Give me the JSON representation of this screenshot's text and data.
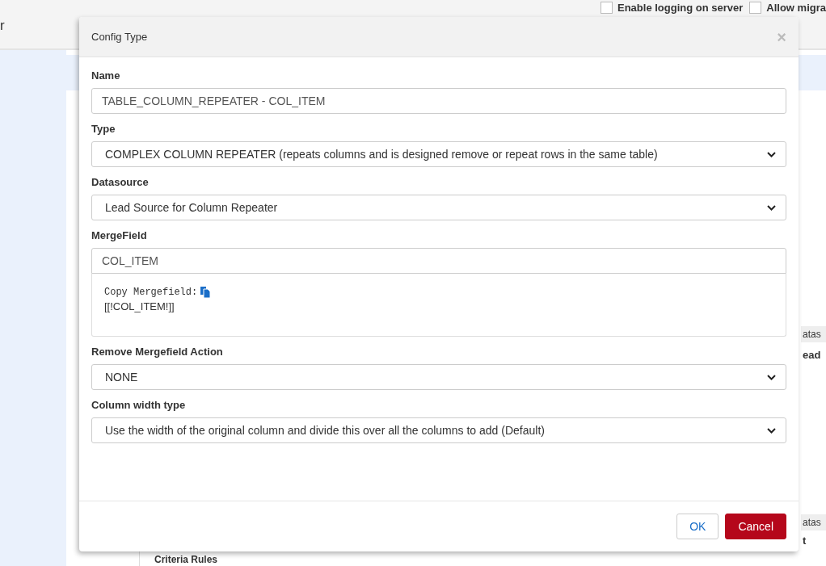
{
  "background": {
    "header_text": "r",
    "checkboxes": [
      {
        "label": "Enable logging on server",
        "checked": false
      },
      {
        "label": "Allow migra",
        "checked": false
      }
    ],
    "column_headers": [
      "atas",
      "atas"
    ],
    "cells": [
      "ead",
      "t"
    ],
    "section_title": "Criteria Rules"
  },
  "dialog": {
    "title": "Config Type",
    "close": "×",
    "fields": [
      {
        "kind": "text",
        "label": "Name",
        "value": "TABLE_COLUMN_REPEATER - COL_ITEM"
      },
      {
        "kind": "select",
        "label": "Type",
        "value": "COMPLEX COLUMN REPEATER (repeats columns and is designed remove or repeat rows in the same table)"
      },
      {
        "kind": "select",
        "label": "Datasource",
        "value": "Lead Source for Column Repeater"
      },
      {
        "kind": "text",
        "label": "MergeField",
        "value": "COL_ITEM",
        "copy_label": "Copy Mergefield:",
        "code": "[[!COL_ITEM!]]"
      },
      {
        "kind": "select",
        "label": "Remove Mergefield Action",
        "value": "NONE"
      },
      {
        "kind": "select",
        "label": "Column width type",
        "value": "Use the width of the original column and divide this over all the columns to add (Default)"
      }
    ],
    "buttons": [
      {
        "kind": "secondary",
        "label": "OK"
      },
      {
        "kind": "danger",
        "label": "Cancel"
      }
    ]
  }
}
